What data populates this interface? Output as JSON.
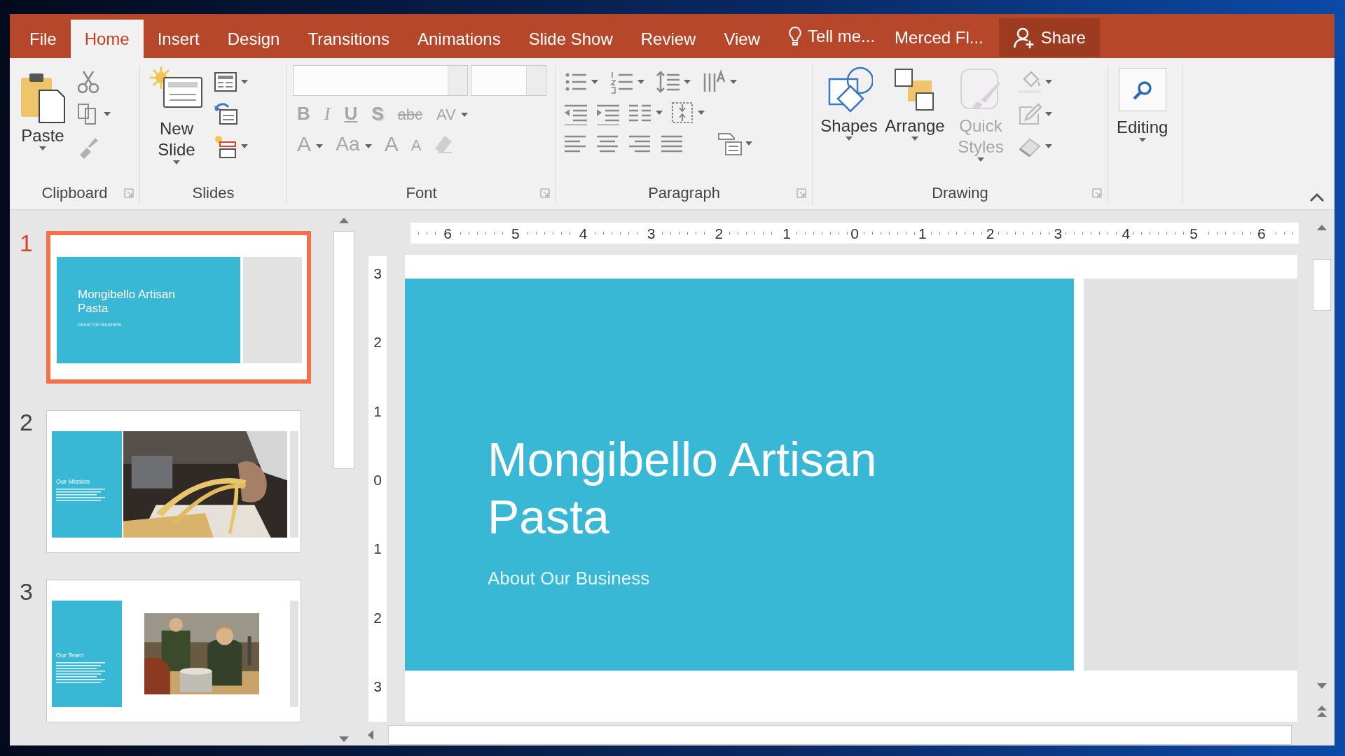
{
  "tabs": [
    {
      "label": "File",
      "selected": false
    },
    {
      "label": "Home",
      "selected": true
    },
    {
      "label": "Insert",
      "selected": false
    },
    {
      "label": "Design",
      "selected": false
    },
    {
      "label": "Transitions",
      "selected": false
    },
    {
      "label": "Animations",
      "selected": false
    },
    {
      "label": "Slide Show",
      "selected": false
    },
    {
      "label": "Review",
      "selected": false
    },
    {
      "label": "View",
      "selected": false
    }
  ],
  "tell_me": "Tell me...",
  "user": "Merced Fl...",
  "share": "Share",
  "ribbon": {
    "clipboard": {
      "label": "Clipboard",
      "paste": "Paste"
    },
    "slides": {
      "label": "Slides",
      "new_slide": "New Slide"
    },
    "font": {
      "label": "Font",
      "buttons": [
        {
          "text": "B",
          "kind": "bold",
          "disabled": true,
          "dropdown": false
        },
        {
          "text": "I",
          "kind": "italic",
          "disabled": true,
          "dropdown": false
        },
        {
          "text": "U",
          "kind": "underline",
          "disabled": true,
          "dropdown": false
        },
        {
          "text": "S",
          "kind": "shadow",
          "disabled": true,
          "dropdown": false
        },
        {
          "text": "abc",
          "kind": "strike",
          "disabled": true,
          "dropdown": false
        },
        {
          "text": "AV",
          "kind": "spacing",
          "disabled": true,
          "dropdown": true
        },
        {
          "text": "A",
          "kind": "color",
          "disabled": true,
          "dropdown": true
        },
        {
          "text": "Aa",
          "kind": "case",
          "disabled": true,
          "dropdown": true
        },
        {
          "text": "A",
          "kind": "grow",
          "disabled": true,
          "dropdown": false
        },
        {
          "text": "A",
          "kind": "shrink",
          "disabled": true,
          "dropdown": false
        }
      ]
    },
    "paragraph": {
      "label": "Paragraph"
    },
    "drawing": {
      "label": "Drawing",
      "buttons": [
        {
          "label": "Shapes",
          "kind": "shapes",
          "disabled": false
        },
        {
          "label": "Arrange",
          "kind": "arrange",
          "disabled": false
        },
        {
          "label": "Quick Styles",
          "kind": "styles",
          "disabled": true
        }
      ]
    },
    "editing": {
      "label": "Editing"
    }
  },
  "thumbnails": [
    {
      "number": "1",
      "selected": true,
      "kind": "title",
      "title": "Mongibello Artisan Pasta",
      "subtitle": "About Our Business"
    },
    {
      "number": "2",
      "selected": false,
      "kind": "photo_wide",
      "title": "Our Mission"
    },
    {
      "number": "3",
      "selected": false,
      "kind": "photo_inset",
      "title": "Our Team"
    }
  ],
  "ruler_h": [
    "6",
    "5",
    "4",
    "3",
    "2",
    "1",
    "0",
    "1",
    "2",
    "3",
    "4",
    "5",
    "6"
  ],
  "ruler_v": [
    "3",
    "2",
    "1",
    "0",
    "1",
    "2",
    "3"
  ],
  "slide": {
    "title": "Mongibello Artisan Pasta",
    "subtitle": "About Our Business"
  }
}
